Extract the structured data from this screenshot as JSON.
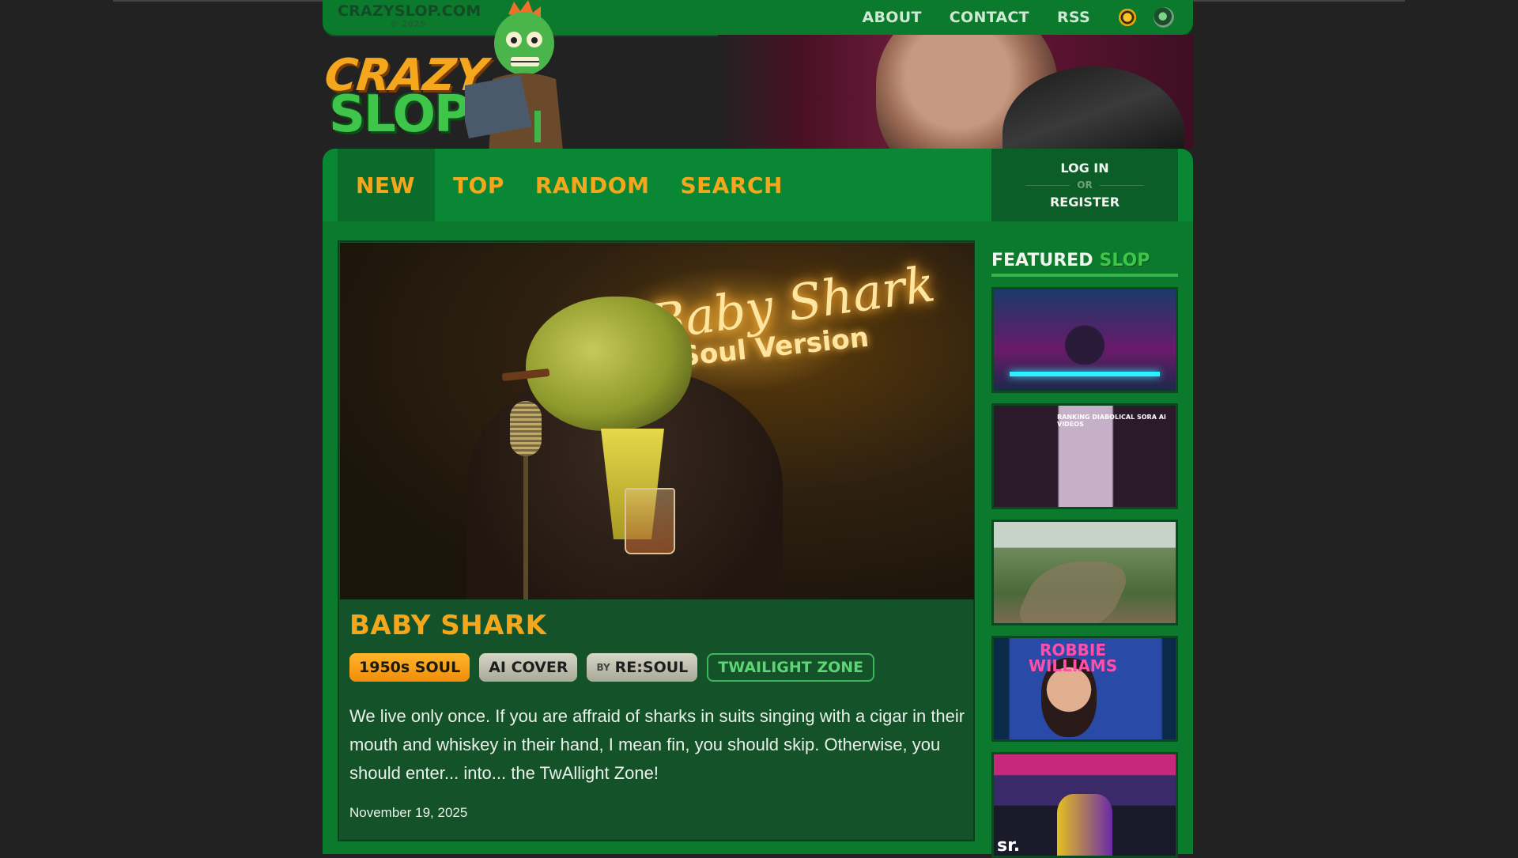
{
  "site": {
    "domain": "CRAZYSLOP.COM",
    "year": "© 2025",
    "logo_line1": "CRAZY",
    "logo_line2": "SLOP"
  },
  "topnav": [
    {
      "label": "ABOUT"
    },
    {
      "label": "CONTACT"
    },
    {
      "label": "RSS"
    }
  ],
  "icons": {
    "theme_light": "sun-icon",
    "theme_dark": "moon-icon"
  },
  "mainnav": [
    {
      "label": "NEW",
      "active": true
    },
    {
      "label": "TOP"
    },
    {
      "label": "RANDOM"
    },
    {
      "label": "SEARCH"
    }
  ],
  "auth": {
    "login": "LOG IN",
    "or": "OR",
    "register": "REGISTER"
  },
  "post": {
    "hero_text_line1": "Baby Shark",
    "hero_text_line2": "Soul Version",
    "title": "BABY SHARK",
    "tags": [
      {
        "label": "1950s SOUL"
      },
      {
        "label": "AI COVER"
      },
      {
        "by": "BY",
        "label": "RE:SOUL"
      },
      {
        "label": "TWAILIGHT ZONE"
      }
    ],
    "description": "We live only once. If you are affraid of sharks in suits singing with a cigar in their mouth and whiskey in their hand, I mean fin, you should skip. Otherwise, you should enter... into... the TwAllight Zone!",
    "date": "November 19, 2025"
  },
  "sidebar": {
    "title_a": "FEATURED",
    "title_b": "SLOP",
    "thumb2_caption": "RANKING DIABOLICAL SORA AI VIDEOS",
    "thumb4_caption": "ROBBIE WILLIAMS",
    "thumb5_caption": "sr."
  },
  "colors": {
    "brand_green": "#0b7a2d",
    "accent_orange": "#f4a71c",
    "bg": "#222222"
  }
}
